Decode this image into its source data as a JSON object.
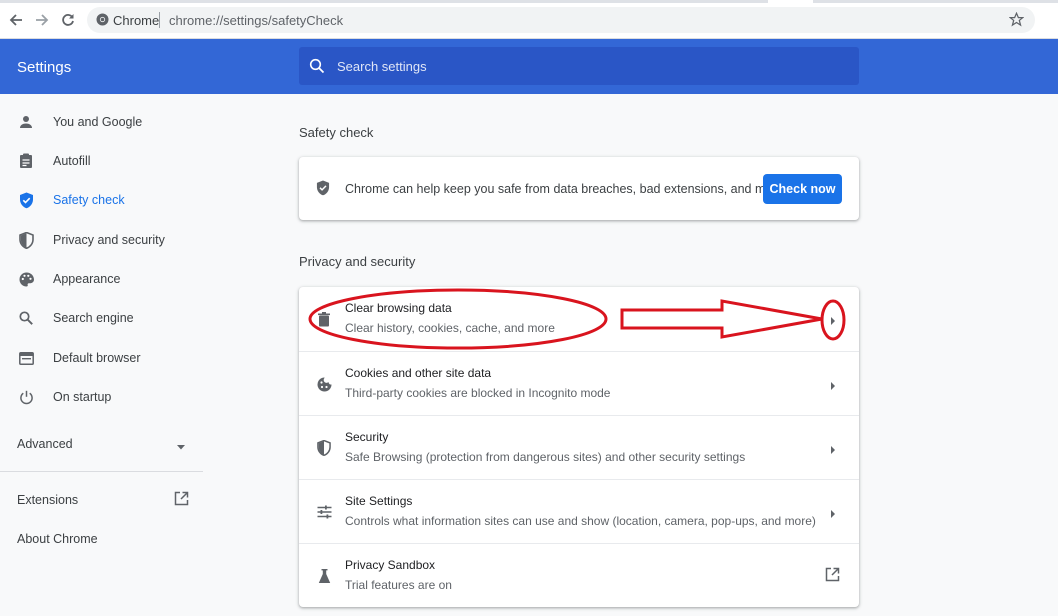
{
  "browser": {
    "site_label": "Chrome",
    "url": "chrome://settings/safetyCheck"
  },
  "header": {
    "title": "Settings",
    "search_placeholder": "Search settings"
  },
  "sidebar": {
    "items": [
      {
        "label": "You and Google",
        "icon": "person-icon"
      },
      {
        "label": "Autofill",
        "icon": "clipboard-icon"
      },
      {
        "label": "Safety check",
        "icon": "shield-check-icon",
        "active": true
      },
      {
        "label": "Privacy and security",
        "icon": "shield-half-icon"
      },
      {
        "label": "Appearance",
        "icon": "palette-icon"
      },
      {
        "label": "Search engine",
        "icon": "search-icon"
      },
      {
        "label": "Default browser",
        "icon": "browser-window-icon"
      },
      {
        "label": "On startup",
        "icon": "power-icon"
      }
    ],
    "advanced_label": "Advanced",
    "extensions_label": "Extensions",
    "about_label": "About Chrome"
  },
  "safety_check": {
    "section_title": "Safety check",
    "description": "Chrome can help keep you safe from data breaches, bad extensions, and more",
    "button_label": "Check now"
  },
  "privacy": {
    "section_title": "Privacy and security",
    "rows": [
      {
        "title": "Clear browsing data",
        "subtitle": "Clear history, cookies, cache, and more",
        "icon": "trash-icon"
      },
      {
        "title": "Cookies and other site data",
        "subtitle": "Third-party cookies are blocked in Incognito mode",
        "icon": "cookie-icon"
      },
      {
        "title": "Security",
        "subtitle": "Safe Browsing (protection from dangerous sites) and other security settings",
        "icon": "shield-half-icon"
      },
      {
        "title": "Site Settings",
        "subtitle": "Controls what information sites can use and show (location, camera, pop-ups, and more)",
        "icon": "sliders-icon"
      },
      {
        "title": "Privacy Sandbox",
        "subtitle": "Trial features are on",
        "icon": "flask-icon"
      }
    ]
  },
  "colors": {
    "header_blue": "#3367d6",
    "accent": "#1a73e8",
    "annotation_red": "#d9141e"
  }
}
